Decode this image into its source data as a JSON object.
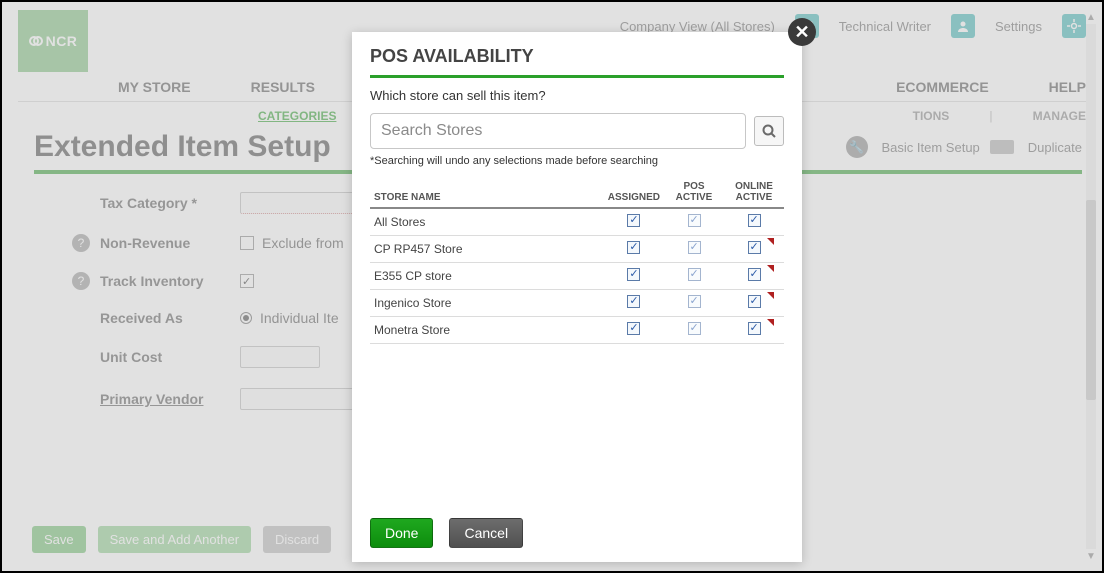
{
  "header": {
    "logo": "NCR",
    "company_view": "Company View (All Stores)",
    "user_role": "Technical Writer",
    "settings": "Settings"
  },
  "mainnav": {
    "my_store": "MY STORE",
    "results": "RESULTS",
    "ecommerce": "ECOMMERCE",
    "help": "HELP"
  },
  "subnav": {
    "categories": "CATEGORIES",
    "tions": "TIONS",
    "manage": "MANAGE"
  },
  "page": {
    "title": "Extended Item Setup",
    "basic_item_setup": "Basic Item Setup",
    "duplicate": "Duplicate"
  },
  "form": {
    "tax_category": "Tax Category *",
    "non_revenue": "Non-Revenue",
    "exclude_from": "Exclude from",
    "track_inventory": "Track Inventory",
    "received_as": "Received As",
    "individual_ite": "Individual Ite",
    "unit_cost": "Unit Cost",
    "primary_vendor": "Primary Vendor"
  },
  "buttons": {
    "save": "Save",
    "save_add": "Save and Add Another",
    "discard": "Discard"
  },
  "modal": {
    "title": "POS AVAILABILITY",
    "subtitle": "Which store can sell this item?",
    "search_placeholder": "Search Stores",
    "search_note": "*Searching will undo any selections made before searching",
    "cols": {
      "store_name": "STORE NAME",
      "assigned": "ASSIGNED",
      "pos_active": "POS ACTIVE",
      "online_active": "ONLINE ACTIVE"
    },
    "rows": [
      {
        "name": "All Stores",
        "assigned": true,
        "pos": true,
        "pos_faded": true,
        "online": true,
        "flag": false
      },
      {
        "name": "CP RP457 Store",
        "assigned": true,
        "pos": true,
        "pos_faded": true,
        "online": true,
        "flag": true
      },
      {
        "name": "E355 CP store",
        "assigned": true,
        "pos": true,
        "pos_faded": true,
        "online": true,
        "flag": true
      },
      {
        "name": "Ingenico Store",
        "assigned": true,
        "pos": true,
        "pos_faded": true,
        "online": true,
        "flag": true
      },
      {
        "name": "Monetra Store",
        "assigned": true,
        "pos": true,
        "pos_faded": true,
        "online": true,
        "flag": true
      }
    ],
    "done": "Done",
    "cancel": "Cancel"
  }
}
